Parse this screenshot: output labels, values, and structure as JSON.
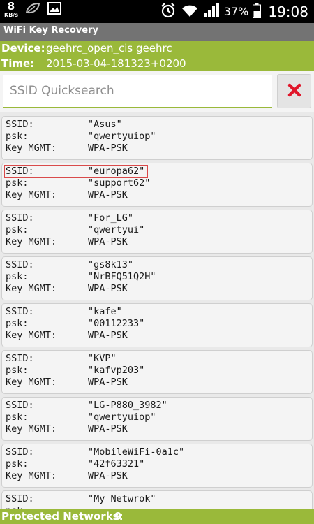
{
  "status_bar": {
    "kb_value": "8",
    "kb_unit": "KB/s",
    "battery_percent": "37%",
    "time": "19:08",
    "icons": [
      "leaf-icon",
      "image-icon",
      "alarm-icon",
      "wifi-icon",
      "signal-icon",
      "battery-icon"
    ]
  },
  "app": {
    "title": "WiFi Key Recovery"
  },
  "info": {
    "device_label": "Device:",
    "device_value": "geehrc_open_cis geehrc",
    "time_label": "Time:",
    "time_value": "2015-03-04-181323+0200"
  },
  "search": {
    "placeholder": "SSID Quicksearch",
    "value": "",
    "clear_icon": "close-x-icon"
  },
  "labels": {
    "ssid": "SSID:",
    "psk": "psk:",
    "key_mgmt": "Key MGMT:"
  },
  "networks": [
    {
      "ssid": "\"Asus\"",
      "psk": "\"qwertyuiop\"",
      "key_mgmt": "WPA-PSK"
    },
    {
      "ssid": "\"europa62\"",
      "psk": "\"support62\"",
      "key_mgmt": "WPA-PSK"
    },
    {
      "ssid": "\"For_LG\"",
      "psk": "\"qwertyui\"",
      "key_mgmt": "WPA-PSK"
    },
    {
      "ssid": "\"gs8k13\"",
      "psk": "\"NrBFQ51Q2H\"",
      "key_mgmt": "WPA-PSK"
    },
    {
      "ssid": "\"kafe\"",
      "psk": "\"00112233\"",
      "key_mgmt": "WPA-PSK"
    },
    {
      "ssid": "\"KVP\"",
      "psk": "\"kafvp203\"",
      "key_mgmt": "WPA-PSK"
    },
    {
      "ssid": "\"LG-P880_3982\"",
      "psk": "\"qwertyuiop\"",
      "key_mgmt": "WPA-PSK"
    },
    {
      "ssid": "\"MobileWiFi-0a1c\"",
      "psk": "\"42f63321\"",
      "key_mgmt": "WPA-PSK"
    },
    {
      "ssid": "\"My Netwrok\"",
      "psk": "",
      "key_mgmt": ""
    }
  ],
  "footer": {
    "label": "Protected Networks:",
    "count": "9"
  }
}
